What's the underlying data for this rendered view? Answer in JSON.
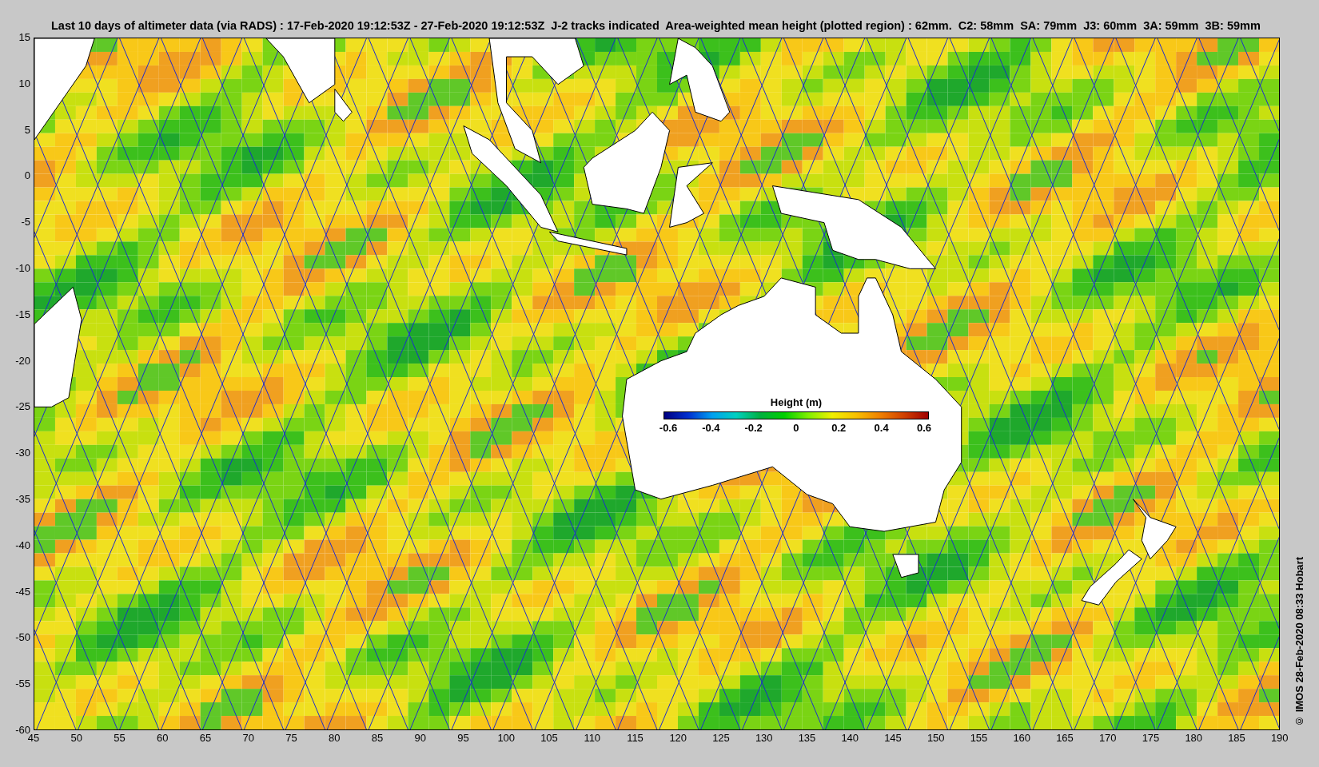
{
  "title": "Last 10 days of altimeter data (via RADS) : 17-Feb-2020 19:12:53Z - 27-Feb-2020 19:12:53Z  J-2 tracks indicated  Area-weighted mean height (plotted region) : 62mm.  C2: 58mm  SA: 79mm  J3: 60mm  3A: 59mm  3B: 59mm",
  "map": {
    "y_axis_labels": [
      "15",
      "10",
      "5",
      "0",
      "-5",
      "-10",
      "-15",
      "-20",
      "-25",
      "-30",
      "-35",
      "-40",
      "-45",
      "-50",
      "-55",
      "-60"
    ],
    "x_axis_labels": [
      "45",
      "50",
      "55",
      "60",
      "65",
      "70",
      "75",
      "80",
      "85",
      "90",
      "95",
      "100",
      "105",
      "110",
      "115",
      "120",
      "125",
      "130",
      "135",
      "140",
      "145",
      "150",
      "155",
      "160",
      "165",
      "170",
      "175",
      "180",
      "185",
      "190"
    ],
    "legend": {
      "title": "Height (m)",
      "ticks": [
        "-0.6",
        "-0.4",
        "-0.2",
        "0",
        "0.2",
        "0.4",
        "0.6"
      ]
    }
  },
  "credit": "© IMOS 28-Feb-2020 08:33 Hobart"
}
